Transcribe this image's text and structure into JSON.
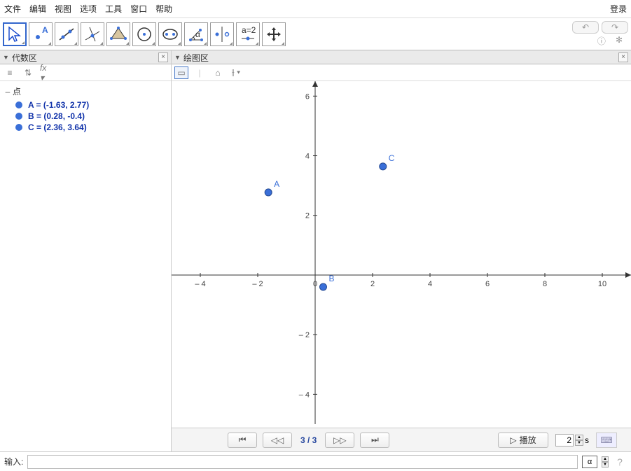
{
  "menu": {
    "items": [
      "文件",
      "编辑",
      "视图",
      "选项",
      "工具",
      "窗口",
      "帮助"
    ],
    "login": "登录"
  },
  "panels": {
    "algebra": {
      "title": "代数区",
      "category_label": "点"
    },
    "graph": {
      "title": "绘图区"
    }
  },
  "points": [
    {
      "name": "A",
      "x": -1.63,
      "y": 2.77,
      "label": "A = (-1.63, 2.77)"
    },
    {
      "name": "B",
      "x": 0.28,
      "y": -0.4,
      "label": "B = (0.28, -0.4)"
    },
    {
      "name": "C",
      "x": 2.36,
      "y": 3.64,
      "label": "C = (2.36, 3.64)"
    }
  ],
  "chart_data": {
    "type": "scatter",
    "title": "",
    "xlabel": "",
    "ylabel": "",
    "xlim": [
      -5,
      11
    ],
    "ylim": [
      -5,
      6.5
    ],
    "x_ticks": [
      -4,
      -2,
      0,
      2,
      4,
      6,
      8,
      10
    ],
    "y_ticks": [
      -4,
      -2,
      2,
      4,
      6
    ],
    "series": [
      {
        "name": "points",
        "data": [
          {
            "label": "A",
            "x": -1.63,
            "y": 2.77
          },
          {
            "label": "B",
            "x": 0.28,
            "y": -0.4
          },
          {
            "label": "C",
            "x": 2.36,
            "y": 3.64
          }
        ]
      }
    ]
  },
  "playback": {
    "counter": "3 / 3",
    "play_label": "播放",
    "speed_value": "2",
    "speed_unit": "s"
  },
  "input": {
    "label": "输入:",
    "value": "",
    "alpha": "α"
  },
  "icons": {
    "help": "?",
    "settings": "✻"
  }
}
